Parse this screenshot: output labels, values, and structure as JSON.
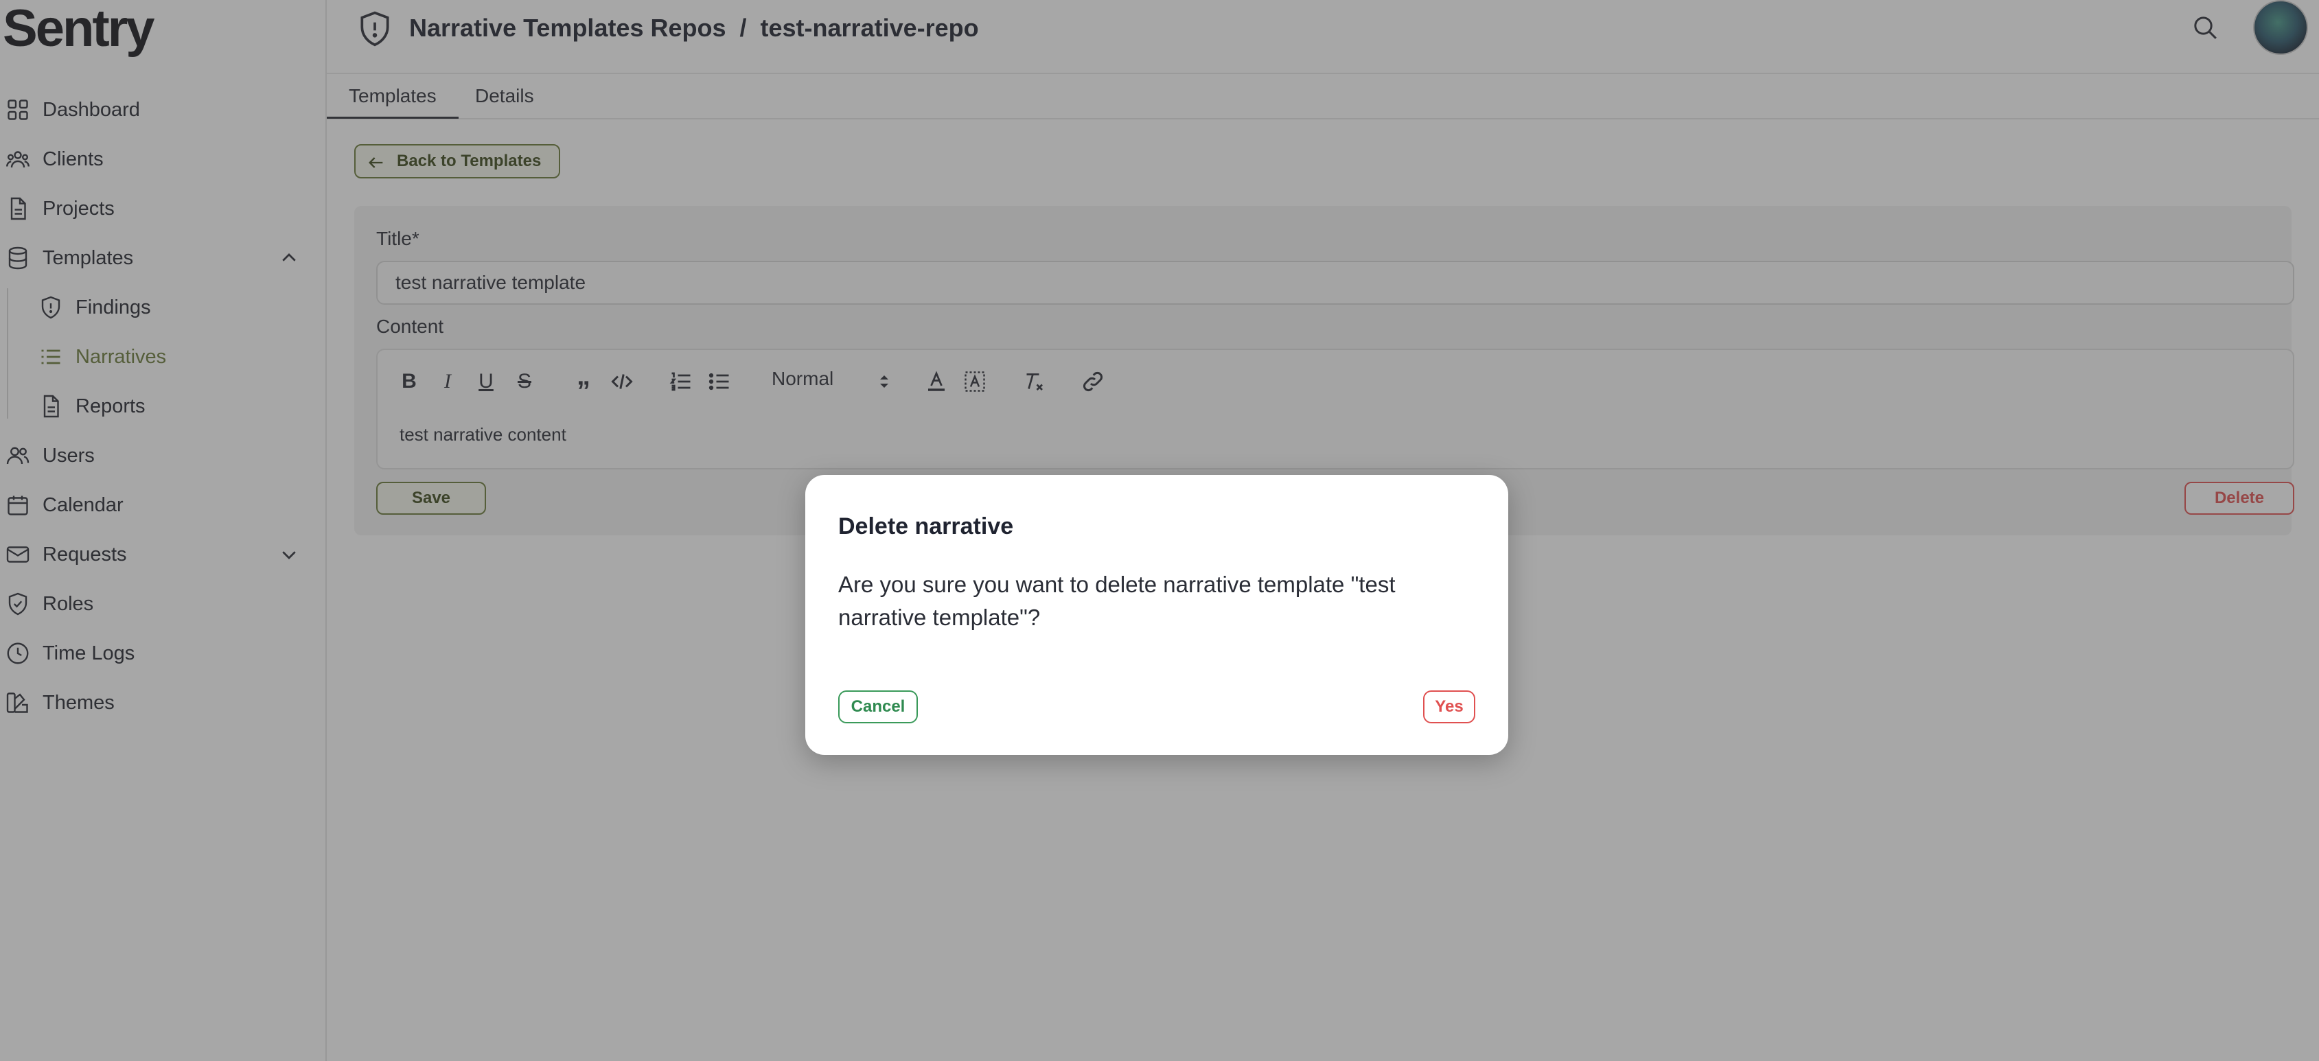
{
  "app": {
    "logo": "Sentry",
    "logo_mark": "™"
  },
  "sidebar": {
    "items": [
      {
        "label": "Dashboard",
        "icon": "grid-icon"
      },
      {
        "label": "Clients",
        "icon": "users-group-icon"
      },
      {
        "label": "Projects",
        "icon": "document-icon"
      },
      {
        "label": "Templates",
        "icon": "database-icon",
        "expanded": true
      },
      {
        "label": "Findings",
        "icon": "shield-alert-icon",
        "sub": true
      },
      {
        "label": "Narratives",
        "icon": "list-icon",
        "sub": true,
        "active": true
      },
      {
        "label": "Reports",
        "icon": "document-icon",
        "sub": true
      },
      {
        "label": "Users",
        "icon": "users-icon"
      },
      {
        "label": "Calendar",
        "icon": "calendar-icon"
      },
      {
        "label": "Requests",
        "icon": "mail-icon",
        "expanded": false
      },
      {
        "label": "Roles",
        "icon": "shield-check-icon"
      },
      {
        "label": "Time Logs",
        "icon": "clock-icon"
      },
      {
        "label": "Themes",
        "icon": "palette-icon"
      }
    ]
  },
  "header": {
    "breadcrumb": "Narrative Templates Repos  /  test-narrative-repo"
  },
  "tabs": [
    {
      "label": "Templates",
      "active": true
    },
    {
      "label": "Details",
      "active": false
    }
  ],
  "main": {
    "back_label": "Back to Templates",
    "title_label": "Title*",
    "title_value": "test narrative template",
    "content_label": "Content",
    "toolbar": {
      "format_select": "Normal"
    },
    "content_value": "test narrative content",
    "save_label": "Save",
    "delete_label": "Delete"
  },
  "modal": {
    "title": "Delete narrative",
    "message": "Are you sure you want to delete narrative template \"test narrative template\"?",
    "cancel_label": "Cancel",
    "yes_label": "Yes"
  },
  "colors": {
    "accent": "#6b7a3a",
    "danger": "#e05050",
    "success": "#2f8a50"
  }
}
